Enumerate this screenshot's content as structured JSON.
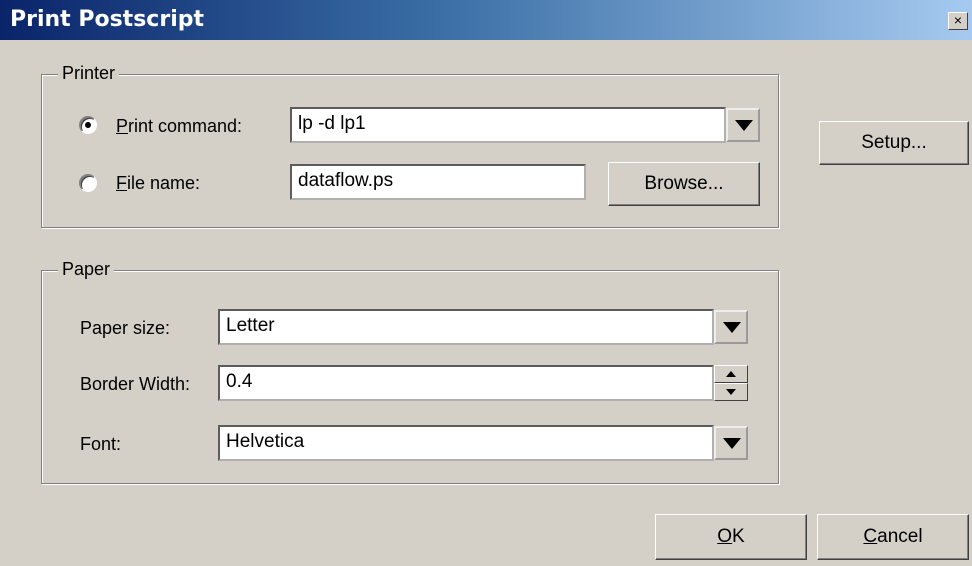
{
  "window": {
    "title": "Print Postscript",
    "close_label": "×"
  },
  "printer": {
    "legend": "Printer",
    "print_command": {
      "label_mnemonic": "P",
      "label_rest": "rint command:",
      "value": "lp -d lp1",
      "selected": true
    },
    "file_name": {
      "label_mnemonic": "F",
      "label_rest": "ile name:",
      "value": "dataflow.ps",
      "selected": false
    },
    "browse_label": "Browse..."
  },
  "setup_label": "Setup...",
  "paper": {
    "legend": "Paper",
    "paper_size": {
      "label": "Paper size:",
      "value": "Letter"
    },
    "border_width": {
      "label": "Border Width:",
      "value": "0.4"
    },
    "font": {
      "label": "Font:",
      "value": "Helvetica"
    }
  },
  "buttons": {
    "ok_mnemonic": "O",
    "ok_rest": "K",
    "cancel_mnemonic": "C",
    "cancel_rest": "ancel"
  }
}
